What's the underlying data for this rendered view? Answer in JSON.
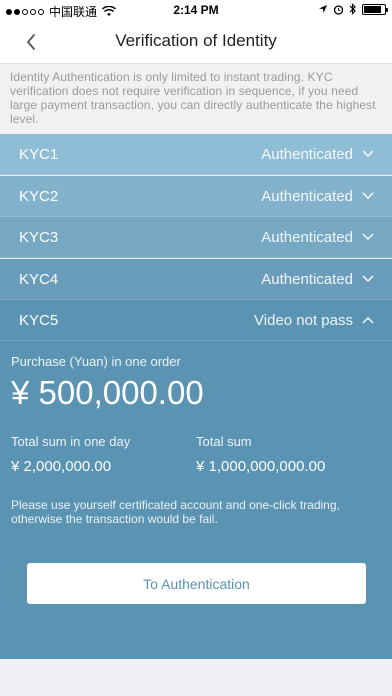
{
  "status_bar": {
    "carrier": "中国联通",
    "time": "2:14 PM"
  },
  "nav": {
    "title": "Verification of Identity",
    "back_icon": "chevron-left-icon"
  },
  "notice": {
    "text": "Identity Authentication is only limited to instant trading. KYC verification does not require verification in sequence, if you need large payment transaction, you can directly authenticate the highest level."
  },
  "kyc_levels": [
    {
      "label": "KYC1",
      "status": "Authenticated",
      "color": "#8fbdd6",
      "expanded": false
    },
    {
      "label": "KYC2",
      "status": "Authenticated",
      "color": "#83b2cc",
      "expanded": false
    },
    {
      "label": "KYC3",
      "status": "Authenticated",
      "color": "#76a8c3",
      "expanded": false
    },
    {
      "label": "KYC4",
      "status": "Authenticated",
      "color": "#6a9dbb",
      "expanded": false
    },
    {
      "label": "KYC5",
      "status": "Video not pass",
      "color": "#5b93b2",
      "expanded": true
    }
  ],
  "detail": {
    "purchase_label": "Purchase (Yuan) in one order",
    "purchase_amount": "¥ 500,000.00",
    "day_label": "Total sum in one day",
    "day_value": "¥ 2,000,000.00",
    "total_label": "Total sum",
    "total_value": "¥ 1,000,000,000.00",
    "hint": "Please use yourself certificated account and one-click trading, otherwise the transaction would be fail.",
    "button_label": "To Authentication"
  },
  "colors": {
    "accent": "#5b93b2"
  }
}
